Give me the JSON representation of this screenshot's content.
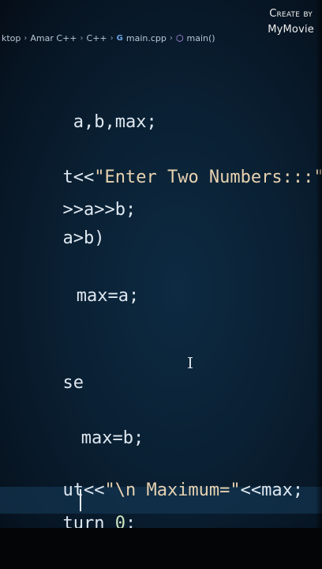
{
  "breadcrumb": {
    "items": [
      "ktop",
      "Amar C++",
      "C++",
      "main.cpp",
      "main()"
    ],
    "file_icon": "c++-file-icon",
    "function_icon": "cube-icon"
  },
  "watermark": {
    "line1": "Create by",
    "line2": "MyMovie"
  },
  "editor": {
    "lines": [
      {
        "id": "l1",
        "text": " a,b,max;"
      },
      {
        "id": "l2",
        "text": "t<<",
        "str": "\"Enter Two Numbers:::\"",
        "tail": ";"
      },
      {
        "id": "l3",
        "text": ">>a>>b;"
      },
      {
        "id": "l4",
        "text": "a>b)"
      },
      {
        "id": "l5",
        "text": " max=a;"
      },
      {
        "id": "l6",
        "text": "se"
      },
      {
        "id": "l7",
        "text": " max=b;"
      },
      {
        "id": "l8",
        "text": "ut<<",
        "str": "\"\\n Maximum=\"",
        "tail": "<<max;"
      },
      {
        "id": "l9",
        "text": "turn ",
        "num": "0",
        "tail": ";"
      }
    ]
  },
  "colors": {
    "editor_bg": "#0a2033",
    "text": "#dfe8f0",
    "string": "#e8d2b0",
    "current_line": "#14374f"
  }
}
